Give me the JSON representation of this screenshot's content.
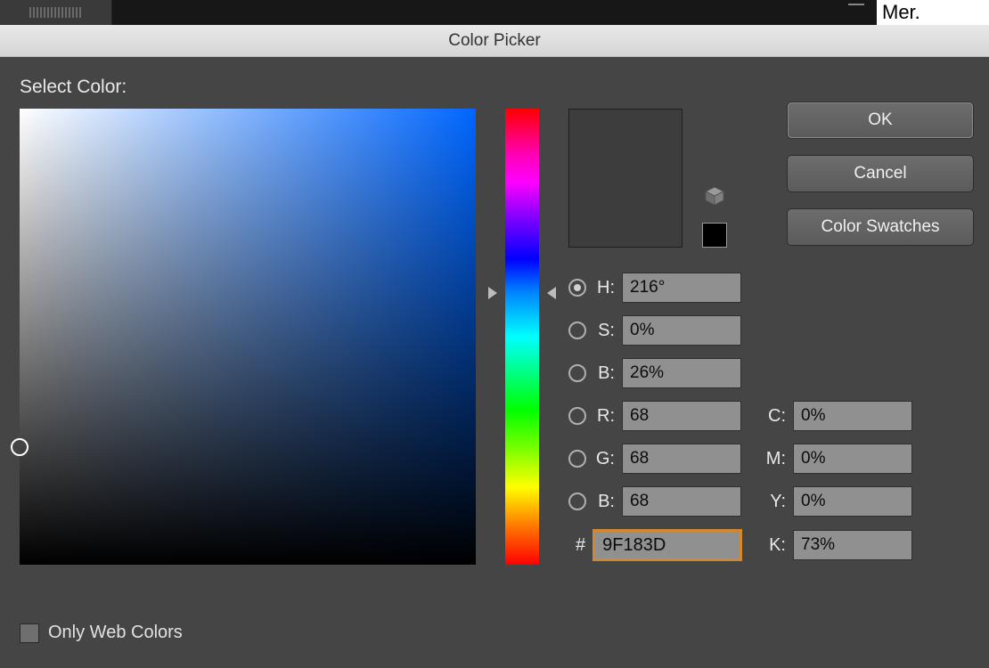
{
  "titlebar": {
    "title": "Color Picker"
  },
  "top_right_text": "Mer.",
  "select_color_label": "Select Color:",
  "buttons": {
    "ok": "OK",
    "cancel": "Cancel",
    "swatches": "Color Swatches"
  },
  "hue_deg": 216,
  "swatch_current": "#3d3d3d",
  "swatch_mini": "#000000",
  "fields": {
    "h": {
      "label": "H:",
      "value": "216°",
      "checked": true
    },
    "s": {
      "label": "S:",
      "value": "0%",
      "checked": false
    },
    "bb": {
      "label": "B:",
      "value": "26%",
      "checked": false
    },
    "r": {
      "label": "R:",
      "value": "68",
      "checked": false
    },
    "g": {
      "label": "G:",
      "value": "68",
      "checked": false
    },
    "b": {
      "label": "B:",
      "value": "68",
      "checked": false
    },
    "hex": {
      "label": "#",
      "value": "9F183D"
    },
    "c": {
      "label": "C:",
      "value": "0%"
    },
    "m": {
      "label": "M:",
      "value": "0%"
    },
    "y": {
      "label": "Y:",
      "value": "0%"
    },
    "k": {
      "label": "K:",
      "value": "73%"
    }
  },
  "web_colors_label": "Only Web Colors",
  "web_colors_checked": false
}
